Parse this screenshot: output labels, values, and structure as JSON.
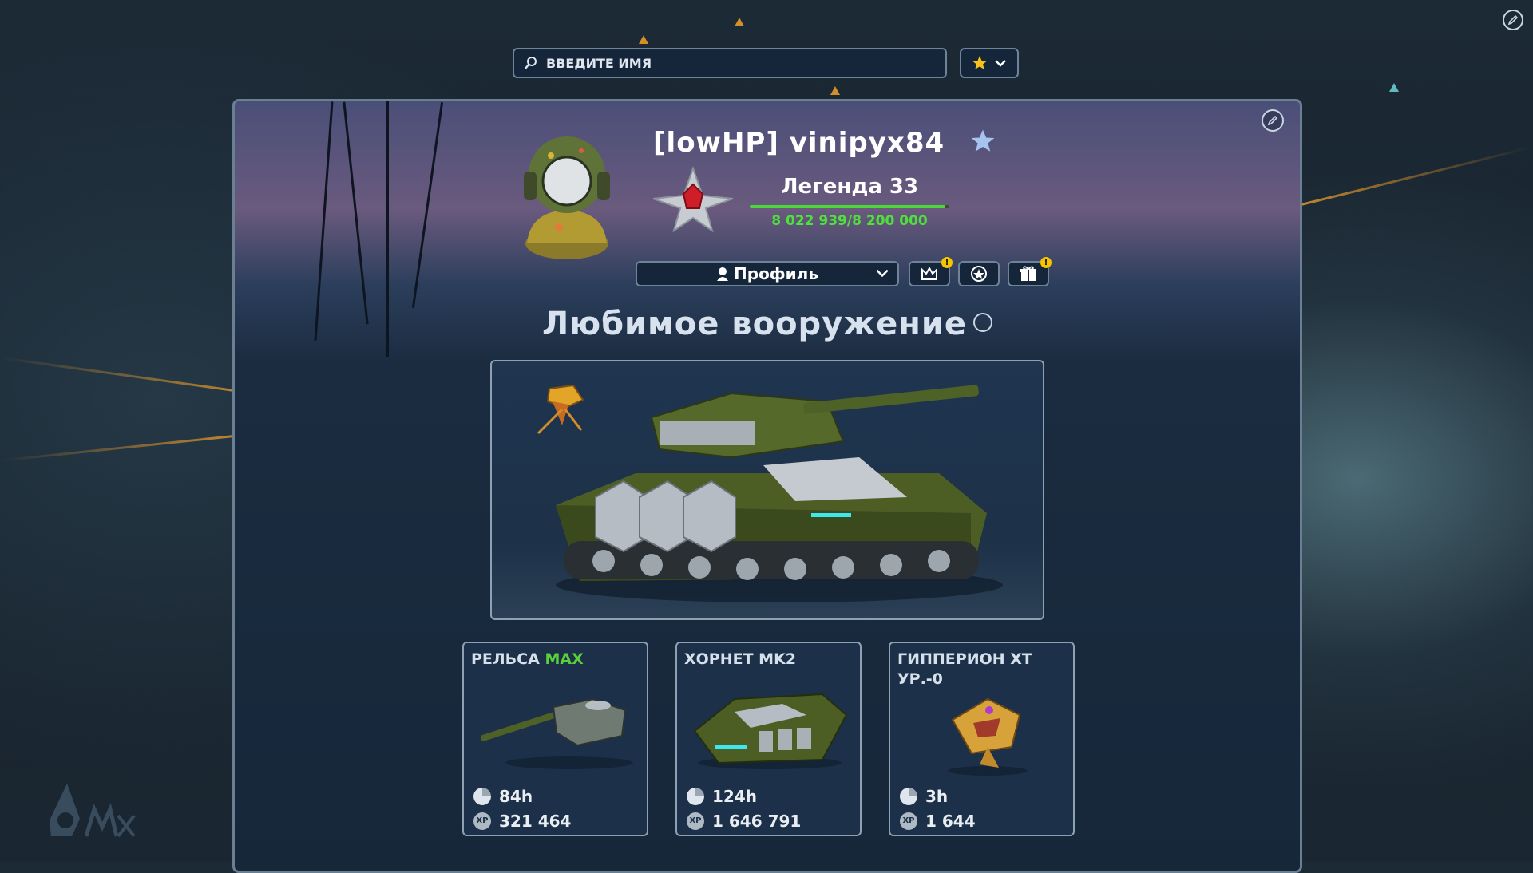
{
  "search": {
    "placeholder": "ВВЕДИТЕ ИМЯ"
  },
  "player": {
    "name": "[lowHP] vinipyx84",
    "rank": "Легенда 33",
    "xp_text": "8 022 939/8 200 000",
    "xp_progress": 0.978
  },
  "profile_menu": {
    "selected": "Профиль"
  },
  "favorites": {
    "title": "Любимое вооружение"
  },
  "cards": [
    {
      "name": "РЕЛЬСА",
      "tag": "MAX",
      "time": "84h",
      "xp": "321 464"
    },
    {
      "name": "ХОРНЕТ MK2",
      "tag": "",
      "time": "124h",
      "xp": "1 646 791"
    },
    {
      "name": "ГИППЕРИОН XT УР.-0",
      "tag": "",
      "time": "3h",
      "xp": "1 644"
    }
  ],
  "icons": {
    "search": "search-icon",
    "favorite_dropdown": "star-icon",
    "edit": "pencil-icon",
    "crown": "crown-icon",
    "badge": "badge-icon",
    "gift": "gift-icon",
    "clock": "clock-icon",
    "xp": "xp-icon"
  },
  "colors": {
    "accent_green": "#4fe03c",
    "max_tag": "#59d23a",
    "notification": "#f5c400"
  },
  "xp_icon_label": "XP"
}
